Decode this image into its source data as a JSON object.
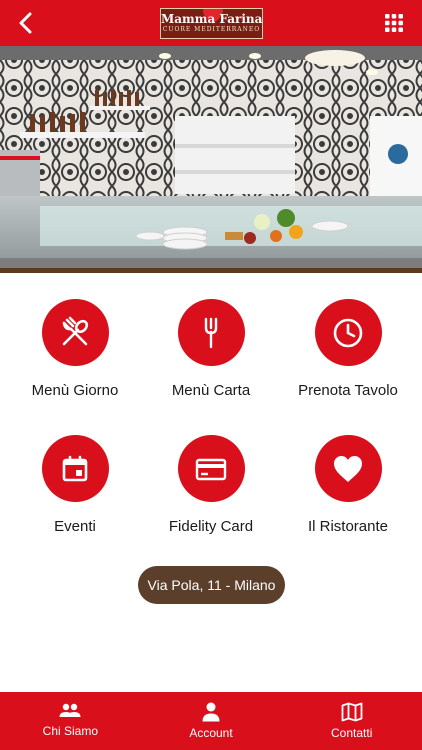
{
  "header": {
    "logo_name": "Mamma Farina",
    "logo_tagline": "CUORE MEDITERRANEO",
    "back_icon": "chevron-left-icon",
    "menu_icon": "grid-icon"
  },
  "colors": {
    "brand_red": "#d90f1b",
    "brown": "#5b3f2b",
    "text": "#1a1a1a"
  },
  "tiles": [
    {
      "label": "Menù Giorno",
      "icon": "utensils-icon"
    },
    {
      "label": "Menù Carta",
      "icon": "fork-icon"
    },
    {
      "label": "Prenota Tavolo",
      "icon": "clock-icon"
    },
    {
      "label": "Eventi",
      "icon": "calendar-icon"
    },
    {
      "label": "Fidelity Card",
      "icon": "credit-card-icon"
    },
    {
      "label": "Il Ristorante",
      "icon": "heart-icon"
    }
  ],
  "address": "Via Pola, 11 - Milano",
  "bottom_nav": [
    {
      "label": "Chi Siamo",
      "icon": "people-icon"
    },
    {
      "label": "Account",
      "icon": "person-icon"
    },
    {
      "label": "Contatti",
      "icon": "map-icon"
    }
  ]
}
